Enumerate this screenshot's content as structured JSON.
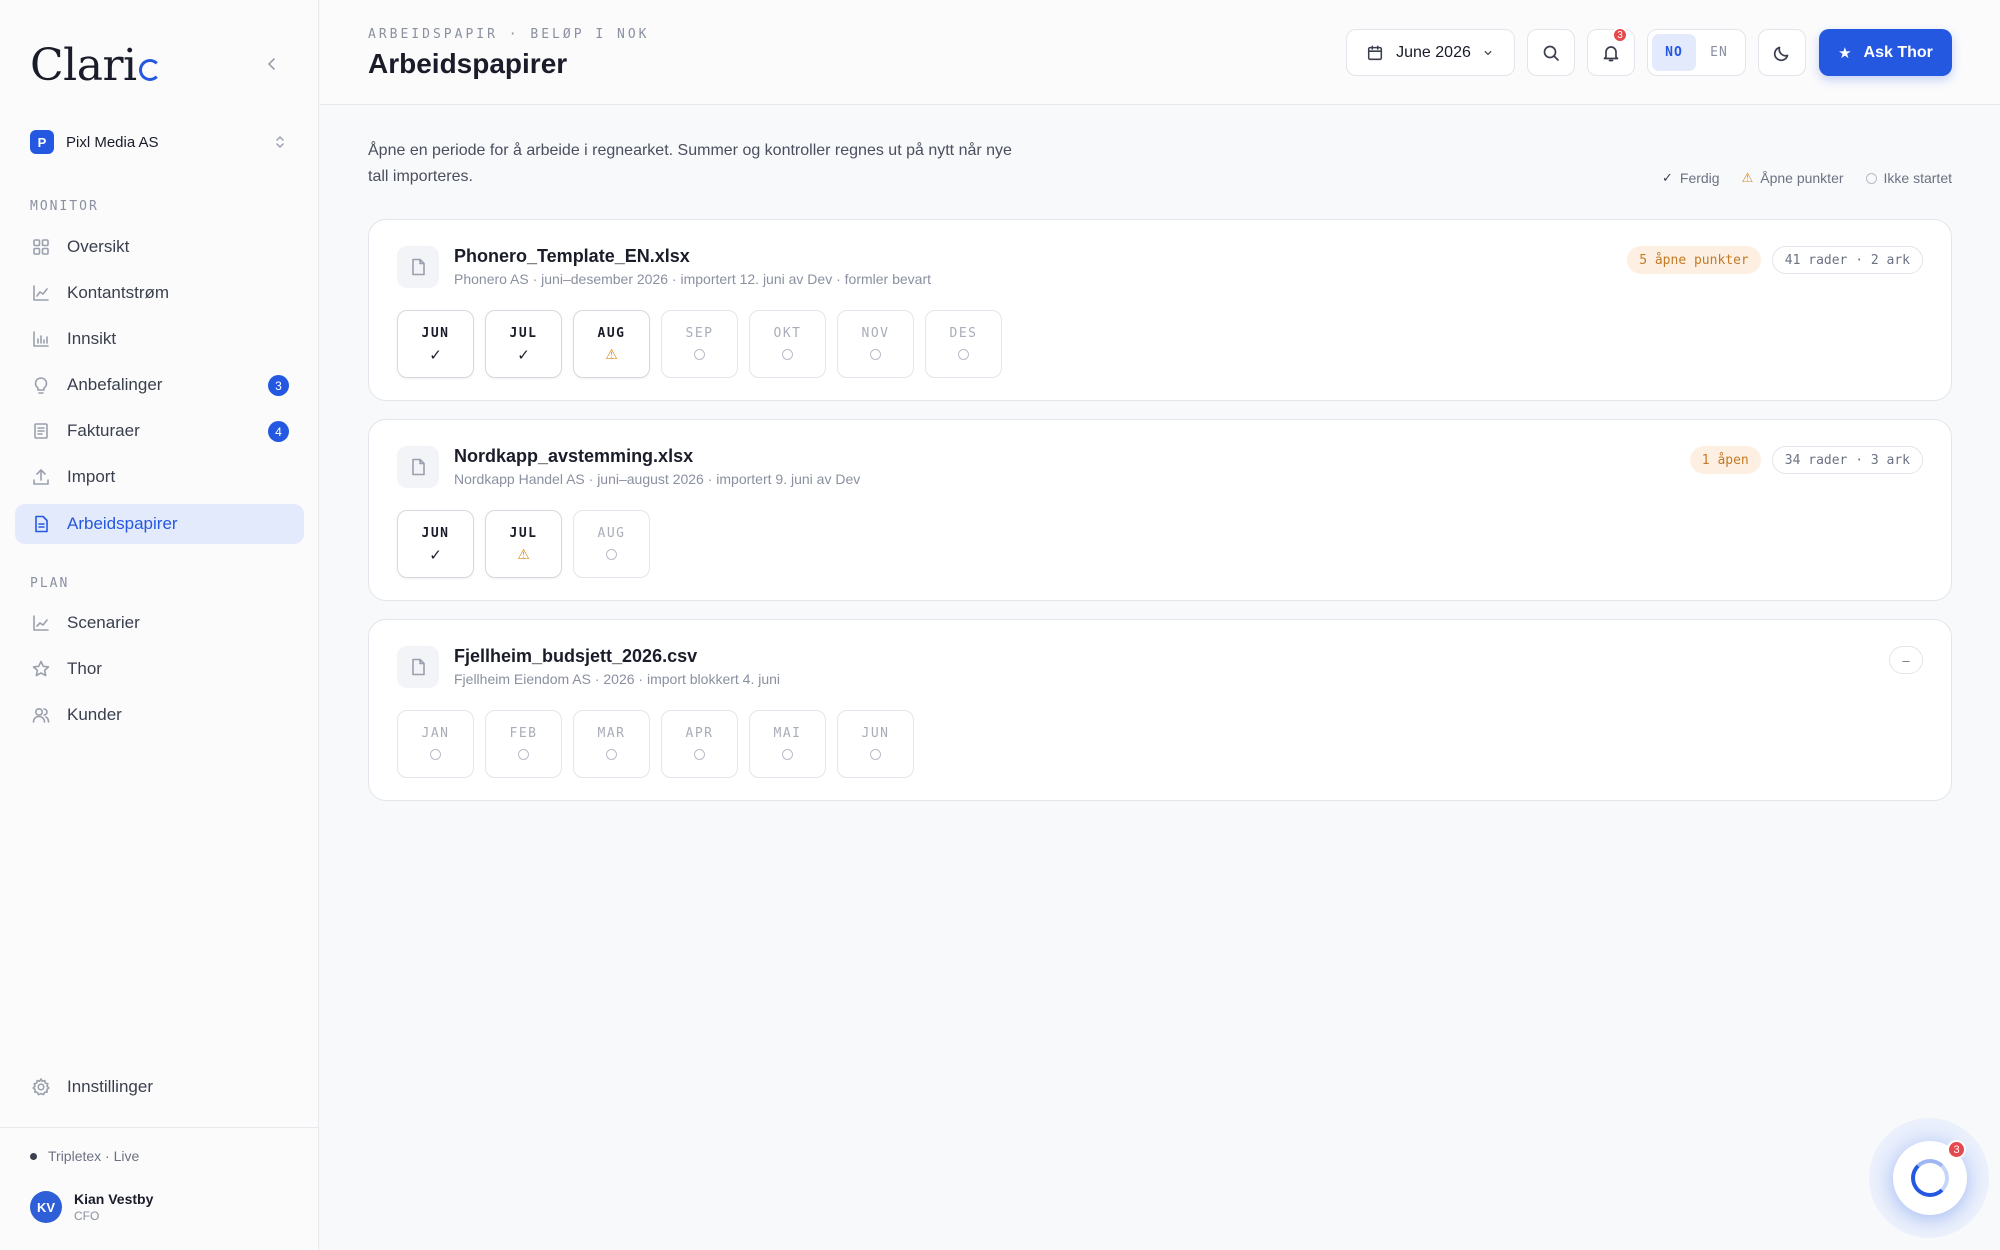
{
  "app": {
    "logo_text": "Clari"
  },
  "org": {
    "badge": "P",
    "name": "Pixl Media AS"
  },
  "sidebar": {
    "sections": [
      {
        "label": "MONITOR"
      },
      {
        "label": "PLAN"
      }
    ],
    "items": [
      {
        "label": "Oversikt",
        "icon": "grid-icon"
      },
      {
        "label": "Kontantstrøm",
        "icon": "line-chart-icon"
      },
      {
        "label": "Innsikt",
        "icon": "bar-chart-icon"
      },
      {
        "label": "Anbefalinger",
        "icon": "lightbulb-icon",
        "count": "3"
      },
      {
        "label": "Fakturaer",
        "icon": "invoice-icon",
        "count": "4"
      },
      {
        "label": "Import",
        "icon": "upload-icon"
      },
      {
        "label": "Arbeidspapirer",
        "icon": "document-icon",
        "active": true
      },
      {
        "label": "Scenarier",
        "icon": "trend-icon"
      },
      {
        "label": "Thor",
        "icon": "star-icon"
      },
      {
        "label": "Kunder",
        "icon": "users-icon"
      }
    ],
    "settings_label": "Innstillinger",
    "status": "Tripletex · Live",
    "user": {
      "initials": "KV",
      "name": "Kian Vestby",
      "role": "CFO"
    }
  },
  "header": {
    "eyebrow": "ARBEIDSPAPIR · BELØP I NOK",
    "title": "Arbeidspapirer",
    "date": "June 2026",
    "notifications": "3",
    "lang": [
      "NO",
      "EN"
    ],
    "lang_selected": "NO",
    "ask_label": "Ask Thor"
  },
  "intro": "Åpne en periode for å arbeide i regnearket. Summer og kontroller regnes ut på nytt når nye tall importeres.",
  "legend": {
    "done": "Ferdig",
    "open": "Åpne punkter",
    "idle": "Ikke startet"
  },
  "workpapers": [
    {
      "file": "Phonero_Template_EN.xlsx",
      "meta": "Phonero AS · juni–desember 2026 · importert 12. juni av Dev · formler bevart",
      "warn_tag": "5 åpne punkter",
      "info_tag": "41 rader · 2 ark",
      "months": [
        {
          "label": "JUN",
          "status": "done"
        },
        {
          "label": "JUL",
          "status": "done"
        },
        {
          "label": "AUG",
          "status": "open"
        },
        {
          "label": "SEP",
          "status": "idle"
        },
        {
          "label": "OKT",
          "status": "idle"
        },
        {
          "label": "NOV",
          "status": "idle"
        },
        {
          "label": "DES",
          "status": "idle"
        }
      ]
    },
    {
      "file": "Nordkapp_avstemming.xlsx",
      "meta": "Nordkapp Handel AS · juni–august 2026 · importert 9. juni av Dev",
      "warn_tag": "1 åpen",
      "info_tag": "34 rader · 3 ark",
      "months": [
        {
          "label": "JUN",
          "status": "done"
        },
        {
          "label": "JUL",
          "status": "open"
        },
        {
          "label": "AUG",
          "status": "idle"
        }
      ]
    },
    {
      "file": "Fjellheim_budsjett_2026.csv",
      "meta": "Fjellheim Eiendom AS · 2026 · import blokkert 4. juni",
      "dash_tag": "–",
      "months": [
        {
          "label": "JAN",
          "status": "idle"
        },
        {
          "label": "FEB",
          "status": "idle"
        },
        {
          "label": "MAR",
          "status": "idle"
        },
        {
          "label": "APR",
          "status": "idle"
        },
        {
          "label": "MAI",
          "status": "idle"
        },
        {
          "label": "JUN",
          "status": "idle"
        }
      ]
    }
  ],
  "widget": {
    "badge": "3"
  },
  "colors": {
    "accent": "#2458e0",
    "warn": "#d98a1f",
    "badge_red": "#e5484d"
  }
}
